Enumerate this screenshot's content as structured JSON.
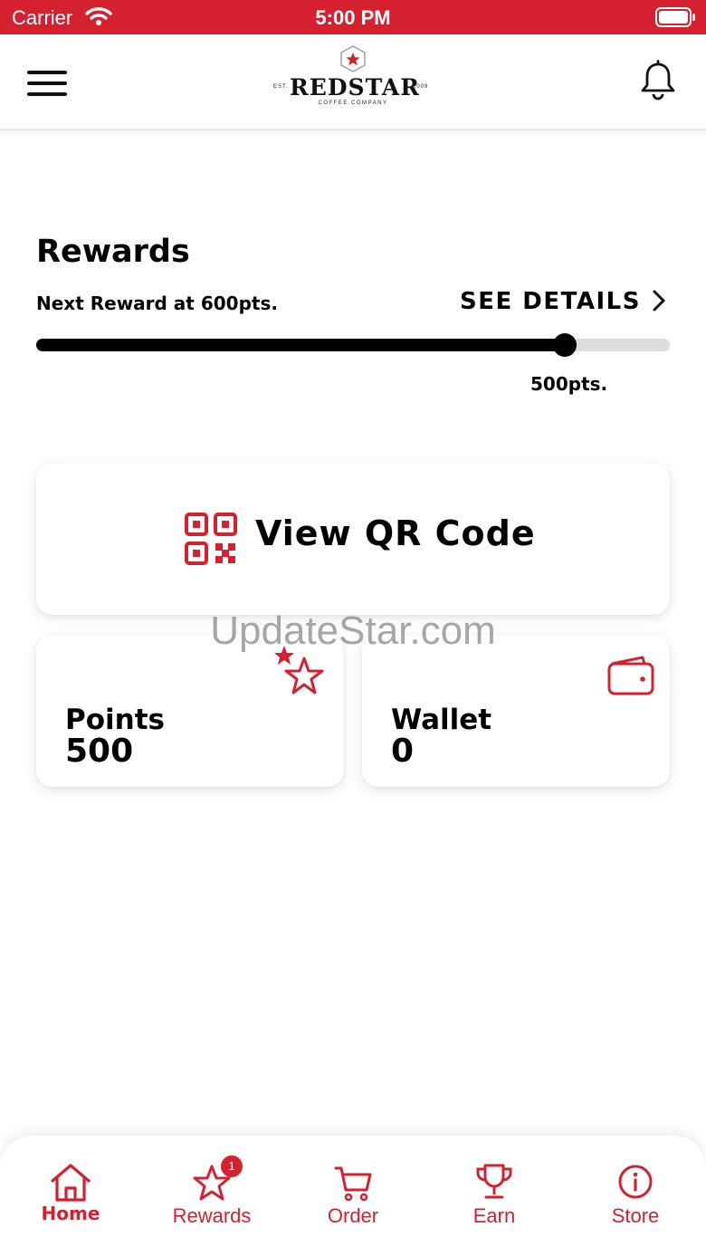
{
  "status_bar": {
    "carrier": "Carrier",
    "time": "5:00 PM"
  },
  "header": {
    "logo": {
      "est": "EST.",
      "name": "REDSTAR",
      "year": "2009",
      "subtitle": "COFFEE COMPANY"
    }
  },
  "rewards": {
    "title": "Rewards",
    "next_reward": "Next Reward at 600pts.",
    "see_details": "SEE DETAILS",
    "progress_fraction": 0.834,
    "progress_label": "500pts."
  },
  "qr": {
    "label": "View QR Code"
  },
  "points_card": {
    "title": "Points",
    "value": "500"
  },
  "wallet_card": {
    "title": "Wallet",
    "value": "0"
  },
  "watermark": "UpdateStar.com",
  "tabs": [
    {
      "label": "Home",
      "icon": "home-icon",
      "active": true
    },
    {
      "label": "Rewards",
      "icon": "star-icon",
      "badge": "1"
    },
    {
      "label": "Order",
      "icon": "cart-icon"
    },
    {
      "label": "Earn",
      "icon": "trophy-icon"
    },
    {
      "label": "Store",
      "icon": "info-icon"
    }
  ],
  "colors": {
    "brand_red": "#d5202f",
    "progress_fill": "#000000",
    "progress_track": "#dddddd"
  }
}
